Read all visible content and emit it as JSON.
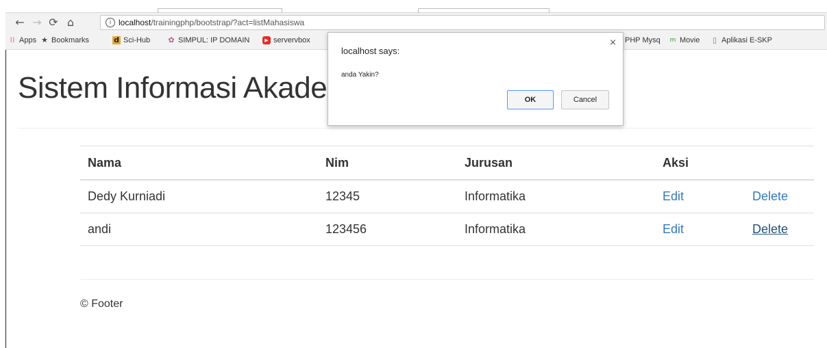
{
  "browser": {
    "url_host": "localhost",
    "url_path": "/trainingphp/bootstrap/?act=listMahasiswa",
    "bookmarks": [
      {
        "icon": "apps-icon",
        "label": "Apps"
      },
      {
        "icon": "star-icon",
        "label": "Bookmarks"
      },
      {
        "icon": "scihub-icon",
        "label": "Sci-Hub"
      },
      {
        "icon": "simpul-icon",
        "label": "SIMPUL: IP DOMAIN"
      },
      {
        "icon": "youtube-icon",
        "label": "servervbox"
      },
      {
        "icon": "bookmark-icon",
        "label": "PHP Mysql lc"
      },
      {
        "icon": "movie-icon",
        "label": "Movie"
      },
      {
        "icon": "page-icon",
        "label": "Aplikasi E-SKP"
      }
    ]
  },
  "page": {
    "title": "Sistem Informasi Akademik",
    "table": {
      "headers": [
        "Nama",
        "Nim",
        "Jurusan",
        "Aksi"
      ],
      "rows": [
        {
          "nama": "Dedy Kurniadi",
          "nim": "12345",
          "jurusan": "Informatika",
          "edit": "Edit",
          "delete": "Delete"
        },
        {
          "nama": "andi",
          "nim": "123456",
          "jurusan": "Informatika",
          "edit": "Edit",
          "delete": "Delete"
        }
      ]
    },
    "footer": "© Footer"
  },
  "dialog": {
    "title": "localhost says:",
    "message": "anda Yakin?",
    "ok_label": "OK",
    "cancel_label": "Cancel"
  },
  "colors": {
    "link": "#337ab7",
    "link_hover": "#23527c",
    "ok_border": "#4d90fe"
  }
}
